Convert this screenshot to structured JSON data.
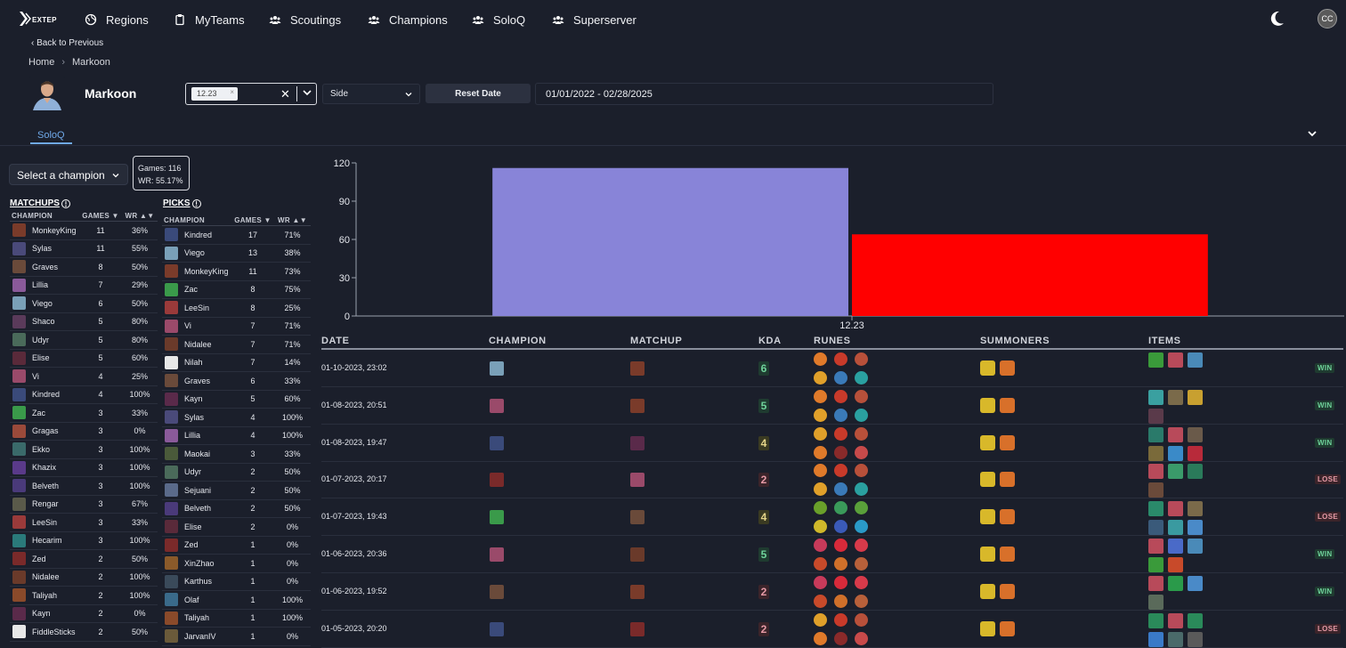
{
  "nav": {
    "logo_text": "EXTEP",
    "items": [
      {
        "label": "Regions",
        "icon": "globe-icon"
      },
      {
        "label": "MyTeams",
        "icon": "clipboard-icon"
      },
      {
        "label": "Scoutings",
        "icon": "users-icon"
      },
      {
        "label": "Champions",
        "icon": "users-icon"
      },
      {
        "label": "SoloQ",
        "icon": "users-icon"
      },
      {
        "label": "Superserver",
        "icon": "users-icon"
      }
    ],
    "avatar_initials": "CC"
  },
  "header": {
    "back_label": "Back to Previous",
    "breadcrumb": [
      "Home",
      "Markoon"
    ],
    "player_name": "Markoon",
    "patch_chip": "12.23",
    "side_placeholder": "Side",
    "reset_label": "Reset Date",
    "date_range": "01/01/2022 - 02/28/2025"
  },
  "tabs": [
    {
      "label": "SoloQ"
    }
  ],
  "left": {
    "champion_select_label": "Select a champion",
    "stats": {
      "games": "Games: 116",
      "wr": "WR: 55.17%"
    },
    "matchups_title": "MATCHUPS",
    "picks_title": "PICKS",
    "columns": {
      "champion": "CHAMPION",
      "games": "GAMES ▼",
      "wr": "WR ▲▼"
    },
    "matchups": [
      {
        "name": "MonkeyKing",
        "games": "11",
        "wr": "36%",
        "color": "#7a3b2a"
      },
      {
        "name": "Sylas",
        "games": "11",
        "wr": "55%",
        "color": "#4a4a7a"
      },
      {
        "name": "Graves",
        "games": "8",
        "wr": "50%",
        "color": "#6a4a3a"
      },
      {
        "name": "Lillia",
        "games": "7",
        "wr": "29%",
        "color": "#8a5a9a"
      },
      {
        "name": "Viego",
        "games": "6",
        "wr": "50%",
        "color": "#7aa0b8"
      },
      {
        "name": "Shaco",
        "games": "5",
        "wr": "80%",
        "color": "#5a3a5a"
      },
      {
        "name": "Udyr",
        "games": "5",
        "wr": "80%",
        "color": "#4a6a5a"
      },
      {
        "name": "Elise",
        "games": "5",
        "wr": "60%",
        "color": "#5a2a3a"
      },
      {
        "name": "Vi",
        "games": "4",
        "wr": "25%",
        "color": "#9a4a6a"
      },
      {
        "name": "Kindred",
        "games": "4",
        "wr": "100%",
        "color": "#3a4a7a"
      },
      {
        "name": "Zac",
        "games": "3",
        "wr": "33%",
        "color": "#3a9a4a"
      },
      {
        "name": "Gragas",
        "games": "3",
        "wr": "0%",
        "color": "#9a4a3a"
      },
      {
        "name": "Ekko",
        "games": "3",
        "wr": "100%",
        "color": "#3a6a6a"
      },
      {
        "name": "Khazix",
        "games": "3",
        "wr": "100%",
        "color": "#5a3a8a"
      },
      {
        "name": "Belveth",
        "games": "3",
        "wr": "100%",
        "color": "#4a3a7a"
      },
      {
        "name": "Rengar",
        "games": "3",
        "wr": "67%",
        "color": "#5a5a4a"
      },
      {
        "name": "LeeSin",
        "games": "3",
        "wr": "33%",
        "color": "#9a3a3a"
      },
      {
        "name": "Hecarim",
        "games": "3",
        "wr": "100%",
        "color": "#2a7a7a"
      },
      {
        "name": "Zed",
        "games": "2",
        "wr": "50%",
        "color": "#7a2a2a"
      },
      {
        "name": "Nidalee",
        "games": "2",
        "wr": "100%",
        "color": "#6a3a2a"
      },
      {
        "name": "Taliyah",
        "games": "2",
        "wr": "100%",
        "color": "#8a4a2a"
      },
      {
        "name": "Kayn",
        "games": "2",
        "wr": "0%",
        "color": "#5a2a4a"
      },
      {
        "name": "FiddleSticks",
        "games": "2",
        "wr": "50%",
        "color": "#e8e8e8"
      }
    ],
    "picks": [
      {
        "name": "Kindred",
        "games": "17",
        "wr": "71%",
        "color": "#3a4a7a"
      },
      {
        "name": "Viego",
        "games": "13",
        "wr": "38%",
        "color": "#7aa0b8"
      },
      {
        "name": "MonkeyKing",
        "games": "11",
        "wr": "73%",
        "color": "#7a3b2a"
      },
      {
        "name": "Zac",
        "games": "8",
        "wr": "75%",
        "color": "#3a9a4a"
      },
      {
        "name": "LeeSin",
        "games": "8",
        "wr": "25%",
        "color": "#9a3a3a"
      },
      {
        "name": "Vi",
        "games": "7",
        "wr": "71%",
        "color": "#9a4a6a"
      },
      {
        "name": "Nidalee",
        "games": "7",
        "wr": "71%",
        "color": "#6a3a2a"
      },
      {
        "name": "Nilah",
        "games": "7",
        "wr": "14%",
        "color": "#e8e8e8"
      },
      {
        "name": "Graves",
        "games": "6",
        "wr": "33%",
        "color": "#6a4a3a"
      },
      {
        "name": "Kayn",
        "games": "5",
        "wr": "60%",
        "color": "#5a2a4a"
      },
      {
        "name": "Sylas",
        "games": "4",
        "wr": "100%",
        "color": "#4a4a7a"
      },
      {
        "name": "Lillia",
        "games": "4",
        "wr": "100%",
        "color": "#8a5a9a"
      },
      {
        "name": "Maokai",
        "games": "3",
        "wr": "33%",
        "color": "#4a5a3a"
      },
      {
        "name": "Udyr",
        "games": "2",
        "wr": "50%",
        "color": "#4a6a5a"
      },
      {
        "name": "Sejuani",
        "games": "2",
        "wr": "50%",
        "color": "#5a6a8a"
      },
      {
        "name": "Belveth",
        "games": "2",
        "wr": "50%",
        "color": "#4a3a7a"
      },
      {
        "name": "Elise",
        "games": "2",
        "wr": "0%",
        "color": "#5a2a3a"
      },
      {
        "name": "Zed",
        "games": "1",
        "wr": "0%",
        "color": "#7a2a2a"
      },
      {
        "name": "XinZhao",
        "games": "1",
        "wr": "0%",
        "color": "#8a5a2a"
      },
      {
        "name": "Karthus",
        "games": "1",
        "wr": "0%",
        "color": "#3a4a5a"
      },
      {
        "name": "Olaf",
        "games": "1",
        "wr": "100%",
        "color": "#3a6a8a"
      },
      {
        "name": "Taliyah",
        "games": "1",
        "wr": "100%",
        "color": "#8a4a2a"
      },
      {
        "name": "JarvanIV",
        "games": "1",
        "wr": "0%",
        "color": "#6a5a3a"
      }
    ]
  },
  "chart_data": {
    "type": "bar",
    "categories": [
      "12.23"
    ],
    "series": [
      {
        "values": [
          116
        ],
        "color": "#8884d8"
      },
      {
        "values": [
          64
        ],
        "color": "#ff0000"
      }
    ],
    "yticks": [
      "0",
      "30",
      "60",
      "90",
      "120"
    ],
    "ylim": [
      0,
      120
    ]
  },
  "matches": {
    "columns": {
      "date": "DATE",
      "champion": "CHAMPION",
      "matchup": "MATCHUP",
      "kda": "KDA",
      "runes": "RUNES",
      "summoners": "SUMMONERS",
      "items": "ITEMS"
    },
    "rows": [
      {
        "date": "01-10-2023, 23:02",
        "champ_color": "#7aa0b8",
        "matchup_color": "#7a3b2a",
        "kda": "6",
        "kda_bg": "#1f3b30",
        "kda_fg": "#6fd39b",
        "result": "WIN",
        "result_class": "win",
        "items": [
          "#3a9a3a",
          "#b84a5a",
          "#4a8ab8"
        ]
      },
      {
        "date": "01-08-2023, 20:51",
        "champ_color": "#9a4a6a",
        "matchup_color": "#7a3b2a",
        "kda": "5",
        "kda_bg": "#1f3b30",
        "kda_fg": "#6fd39b",
        "result": "WIN",
        "result_class": "win",
        "items": [
          "#3aa0a0",
          "#7a6a4a",
          "#c8a030",
          "#5a3a4a"
        ]
      },
      {
        "date": "01-08-2023, 19:47",
        "champ_color": "#3a4a7a",
        "matchup_color": "#5a2a4a",
        "kda": "4",
        "kda_bg": "#3a3a22",
        "kda_fg": "#e6d68a",
        "result": "WIN",
        "result_class": "win",
        "items": [
          "#2a7a6a",
          "#b84a5a",
          "#6a5a4a",
          "#7a6a3a",
          "#3a8ac8",
          "#b82a3a"
        ]
      },
      {
        "date": "01-07-2023, 20:17",
        "champ_color": "#7a2a2a",
        "matchup_color": "#9a4a6a",
        "kda": "2",
        "kda_bg": "#3b242a",
        "kda_fg": "#e69aa6",
        "result": "LOSE",
        "result_class": "lose",
        "items": [
          "#b84a5a",
          "#3a9a6a",
          "#2a7a5a",
          "#6a4a3a"
        ]
      },
      {
        "date": "01-07-2023, 19:43",
        "champ_color": "#3a9a4a",
        "matchup_color": "#6a4a3a",
        "kda": "4",
        "kda_bg": "#3a3a22",
        "kda_fg": "#e6d68a",
        "result": "LOSE",
        "result_class": "lose",
        "items": [
          "#2a8a6a",
          "#b84a5a",
          "#7a6a4a",
          "#3a5a7a",
          "#3a9aa0",
          "#4a8ac8"
        ]
      },
      {
        "date": "01-06-2023, 20:36",
        "champ_color": "#9a4a6a",
        "matchup_color": "#6a3a2a",
        "kda": "5",
        "kda_bg": "#1f3b30",
        "kda_fg": "#6fd39b",
        "result": "WIN",
        "result_class": "win",
        "items": [
          "#b84a5a",
          "#4a6ac8",
          "#4a8ab8",
          "#3a9a3a",
          "#c84a2a"
        ]
      },
      {
        "date": "01-06-2023, 19:52",
        "champ_color": "#6a4a3a",
        "matchup_color": "#7a3b2a",
        "kda": "2",
        "kda_bg": "#3b242a",
        "kda_fg": "#e69aa6",
        "result": "WIN",
        "result_class": "win",
        "items": [
          "#b84a5a",
          "#2a9a4a",
          "#4a8ac8",
          "#5a6a5a"
        ]
      },
      {
        "date": "01-05-2023, 20:20",
        "champ_color": "#3a4a7a",
        "matchup_color": "#7a2a2a",
        "kda": "2",
        "kda_bg": "#3b242a",
        "kda_fg": "#e69aa6",
        "result": "LOSE",
        "result_class": "lose",
        "items": [
          "#2a8a5a",
          "#b84a5a",
          "#2a8a5a",
          "#3a7ac8",
          "#4a6a6a",
          "#5a5a5a"
        ]
      }
    ]
  }
}
